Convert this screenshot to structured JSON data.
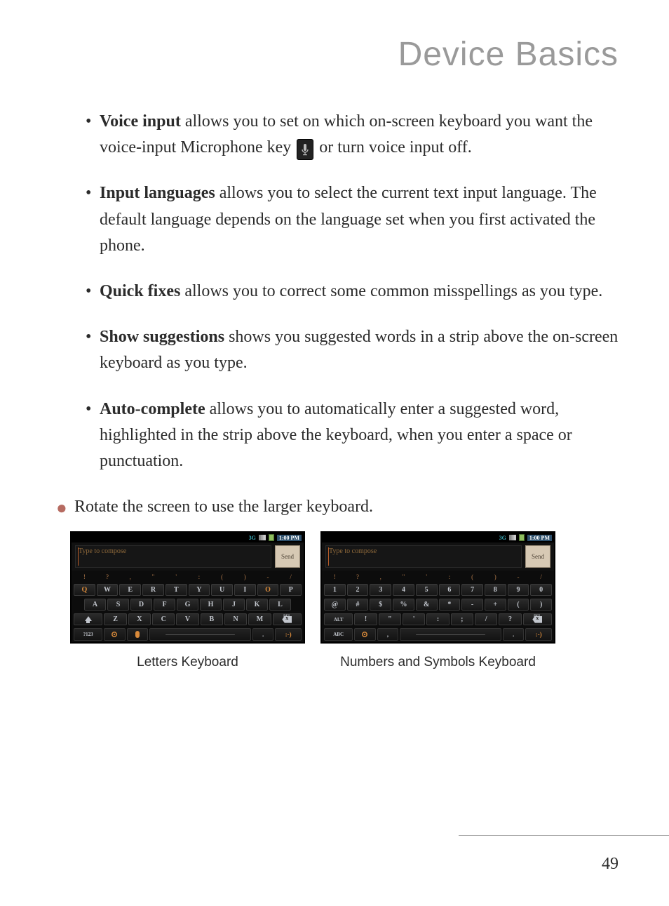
{
  "page": {
    "title": "Device Basics",
    "number": "49"
  },
  "bullets": [
    {
      "term": "Voice input",
      "text_before": " allows you to set on which on-screen keyboard you want the voice-input Microphone key ",
      "text_after": " or turn voice input off.",
      "has_icon": true
    },
    {
      "term": "Input languages",
      "text_before": " allows you to select the current text input language. The default language depends on the language set when you first activated the phone.",
      "text_after": "",
      "has_icon": false
    },
    {
      "term": "Quick fixes",
      "text_before": " allows you to correct some common misspellings as you type.",
      "text_after": "",
      "has_icon": false
    },
    {
      "term": "Show suggestions",
      "text_before": " shows you suggested words in a strip above the on-screen keyboard as you type.",
      "text_after": "",
      "has_icon": false
    },
    {
      "term": "Auto-complete",
      "text_before": " allows you to automatically enter a suggested word, highlighted in the strip above the keyboard, when you enter a space or punctuation.",
      "text_after": "",
      "has_icon": false
    }
  ],
  "outer_bullet": "Rotate the screen to use the larger keyboard.",
  "status": {
    "threeg": "3G",
    "time": "1:00 PM"
  },
  "compose": {
    "placeholder": "Type to compose",
    "send": "Send"
  },
  "letters": {
    "sym_row": [
      "!",
      "?",
      ",",
      "\"",
      "'",
      ":",
      "(",
      ")",
      "-",
      "/"
    ],
    "row1": [
      "Q",
      "W",
      "E",
      "R",
      "T",
      "Y",
      "U",
      "I",
      "O",
      "P"
    ],
    "row2": [
      "A",
      "S",
      "D",
      "F",
      "G",
      "H",
      "J",
      "K",
      "L"
    ],
    "row3": [
      "Z",
      "X",
      "C",
      "V",
      "B",
      "N",
      "M"
    ],
    "mode": "?123",
    "del": "DEL",
    "period": ".",
    "smile": ":-)"
  },
  "numbers": {
    "sym_row": [
      "!",
      "?",
      ",",
      "\"",
      "'",
      ":",
      "(",
      ")",
      "-",
      "/"
    ],
    "row1": [
      "1",
      "2",
      "3",
      "4",
      "5",
      "6",
      "7",
      "8",
      "9",
      "0"
    ],
    "row2": [
      "@",
      "#",
      "$",
      "%",
      "&",
      "*",
      "-",
      "+",
      "(",
      ")"
    ],
    "row3_alt": "ALT",
    "row3": [
      "!",
      "\"",
      "'",
      ":",
      ";",
      "/",
      "?"
    ],
    "mode": "ABC",
    "del": "DEL",
    "comma": ",",
    "period": ".",
    "smile": ":-)"
  },
  "captions": {
    "letters": "Letters Keyboard",
    "numbers": "Numbers and Symbols Keyboard"
  }
}
